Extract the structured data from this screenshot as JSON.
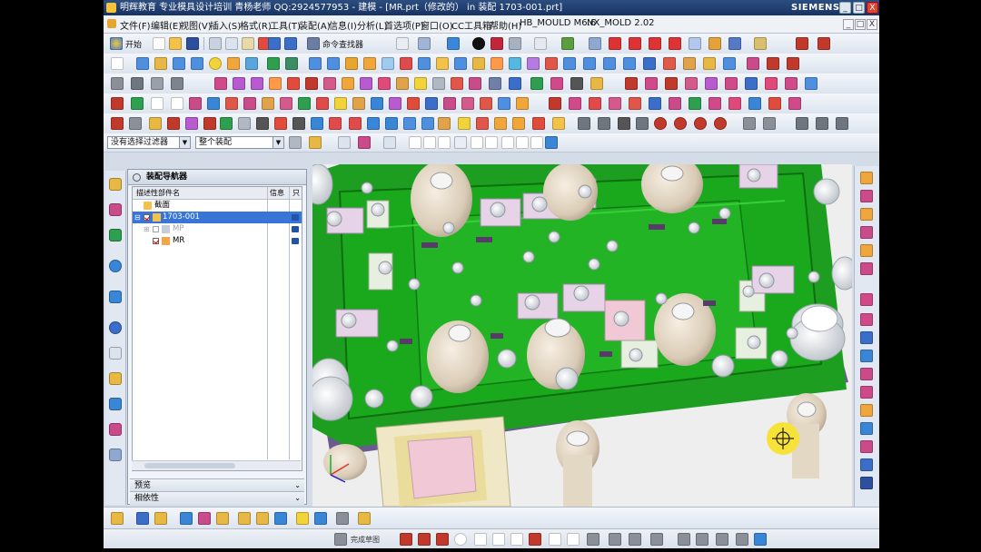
{
  "titlebar": {
    "text": "明辉教育 专业模具设计培训 青杨老师 QQ:2924577953 - 建模 - [MR.prt（修改的） in 装配 1703-001.prt]",
    "brand": "SIEMENS",
    "min_glyph": "_",
    "max_glyph": "□",
    "close_glyph": "X"
  },
  "menubar": {
    "items": [
      "文件(F)",
      "编辑(E)",
      "视图(V)",
      "插入(S)",
      "格式(R)",
      "工具(T)",
      "装配(A)",
      "信息(I)",
      "分析(L)",
      "首选项(P)",
      "窗口(O)",
      "CC工具箱",
      "帮助(H)",
      "HB_MOULD M6.6",
      "NX_MOLD 2.02"
    ],
    "doc_min": "_",
    "doc_max": "□",
    "doc_close": "X"
  },
  "toolbar": {
    "start_label": "开始",
    "command_finder_label": "命令查找器"
  },
  "selection_bar": {
    "filter_value": "没有选择过滤器",
    "scope_value": "整个装配",
    "dropdown_glyph": "▼"
  },
  "assembly_navigator": {
    "title": "装配导航器",
    "columns": {
      "name": "描述性部件名",
      "info": "信息",
      "readonly": "只"
    },
    "rows": [
      {
        "label": "截面",
        "indent": 0
      },
      {
        "label": "1703-001",
        "indent": 0,
        "selected": true
      },
      {
        "label": "MP",
        "indent": 1,
        "dim": true
      },
      {
        "label": "MR",
        "indent": 1
      }
    ],
    "preview_label": "预览",
    "dependency_label": "相依性",
    "chevron_glyph": "⌄"
  },
  "status": {
    "sketch_label": "完成草图"
  },
  "colors": {
    "title_bar": "#1f3d70",
    "selection": "#3875d7",
    "plate_green": "#1e9e21",
    "highlight": "#1ed11e",
    "cursor_marker": "#f7e23a"
  }
}
